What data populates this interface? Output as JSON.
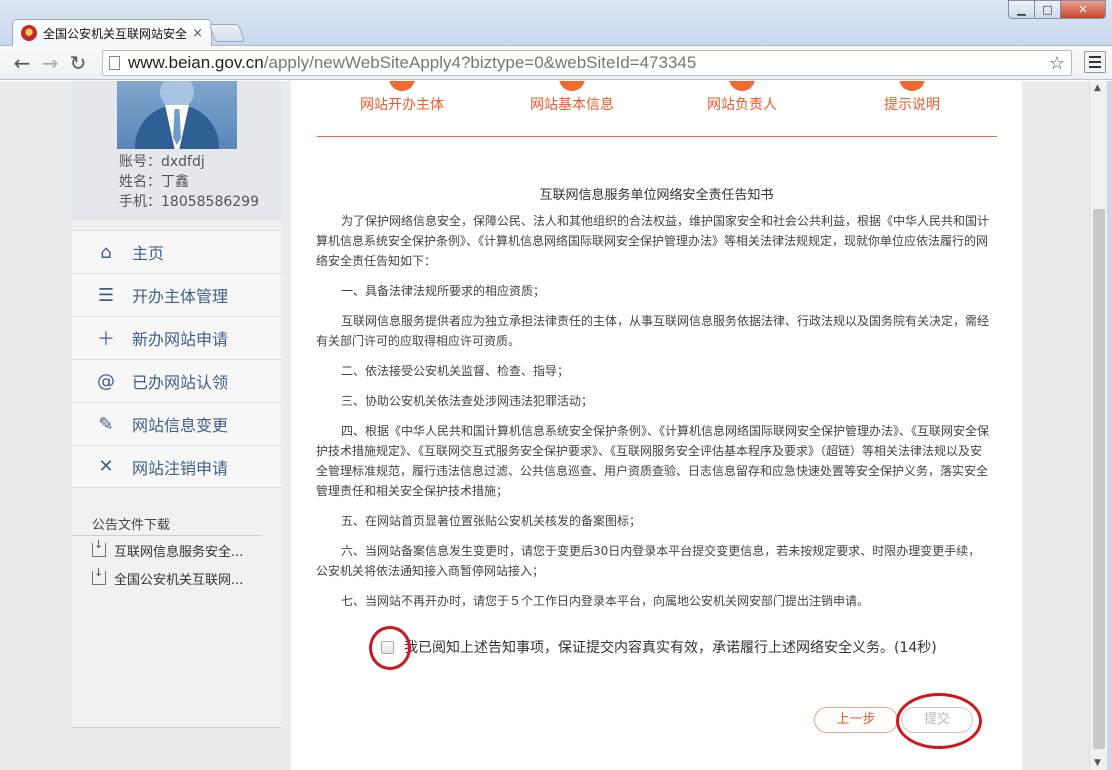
{
  "browser": {
    "tab_title": "全国公安机关互联网站安全",
    "url_host": "www.beian.gov.cn",
    "url_path": "/apply/newWebSiteApply4?biztype=0&webSiteId=473345"
  },
  "profile": {
    "account": "账号：dxdfdj",
    "name": "姓名：丁鑫",
    "phone": "手机：18058586299"
  },
  "nav": [
    {
      "label": "主页",
      "icon": "home-icon"
    },
    {
      "label": "开办主体管理",
      "icon": "list-icon"
    },
    {
      "label": "新办网站申请",
      "icon": "plus-icon"
    },
    {
      "label": "已办网站认领",
      "icon": "at-icon"
    },
    {
      "label": "网站信息变更",
      "icon": "edit-icon"
    },
    {
      "label": "网站注销申请",
      "icon": "close-icon"
    }
  ],
  "downloads": {
    "title": "公告文件下载",
    "items": [
      "互联网信息服务安全...",
      "全国公安机关互联网..."
    ]
  },
  "steps": [
    "网站开办主体",
    "网站基本信息",
    "网站负责人",
    "提示说明"
  ],
  "notice": {
    "title": "互联网信息服务单位网络安全责任告知书",
    "paragraphs": [
      "为了保护网络信息安全，保障公民、法人和其他组织的合法权益，维护国家安全和社会公共利益，根据《中华人民共和国计算机信息系统安全保护条例》、《计算机信息网络国际联网安全保护管理办法》等相关法律法规规定，现就你单位应依法履行的网络安全责任告知如下：",
      "一、具备法律法规所要求的相应资质；",
      "互联网信息服务提供者应为独立承担法律责任的主体，从事互联网信息服务依据法律、行政法规以及国务院有关决定，需经有关部门许可的应取得相应许可资质。",
      "二、依法接受公安机关监督、检查、指导；",
      "三、协助公安机关依法查处涉网违法犯罪活动；",
      "四、根据《中华人民共和国计算机信息系统安全保护条例》、《计算机信息网络国际联网安全保护管理办法》、《互联网安全保护技术措施规定》、《互联网交互式服务安全保护要求》、《互联网服务安全评估基本程序及要求》（超链）等相关法律法规以及安全管理标准规范，履行违法信息过滤、公共信息巡查、用户资质查验、日志信息留存和应急快速处置等安全保护义务，落实安全管理责任和相关安全保护技术措施；",
      "五、在网站首页显著位置张贴公安机关核发的备案图标；",
      "六、当网站备案信息发生变更时，请您于变更后30日内登录本平台提交变更信息，若未按规定要求、时限办理变更手续，公安机关将依法通知接入商暂停网站接入；",
      "七、当网站不再开办时，请您于５个工作日内登录本平台，向属地公安机关网安部门提出注销申请。"
    ]
  },
  "agree_text": "我已阅知上述告知事项，保证提交内容真实有效，承诺履行上述网络安全义务。(14秒)",
  "buttons": {
    "prev": "上一步",
    "submit": "提交"
  }
}
